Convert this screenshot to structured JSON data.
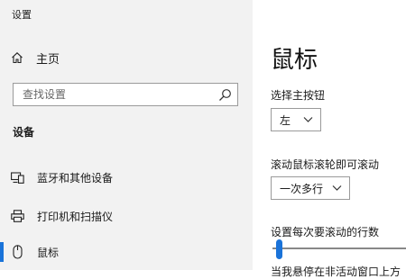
{
  "window": {
    "title": "设置"
  },
  "sidebar": {
    "home_label": "主页",
    "search_placeholder": "查找设置",
    "section_title": "设备",
    "items": [
      {
        "label": "蓝牙和其他设备",
        "icon": "bluetooth-devices-icon"
      },
      {
        "label": "打印机和扫描仪",
        "icon": "printer-icon"
      },
      {
        "label": "鼠标",
        "icon": "mouse-icon",
        "selected": true
      }
    ]
  },
  "main": {
    "title": "鼠标",
    "primary_button": {
      "label": "选择主按钮",
      "value": "左"
    },
    "wheel_scroll": {
      "label": "滚动鼠标滚轮即可滚动",
      "value": "一次多行"
    },
    "lines_per_scroll": {
      "label": "设置每次要滚动的行数",
      "value_fraction": 0.03
    },
    "next_setting_label": "当我悬停在非活动窗口上方"
  },
  "colors": {
    "accent": "#1a73d9",
    "sidebar_bg": "#f2f2f2"
  }
}
